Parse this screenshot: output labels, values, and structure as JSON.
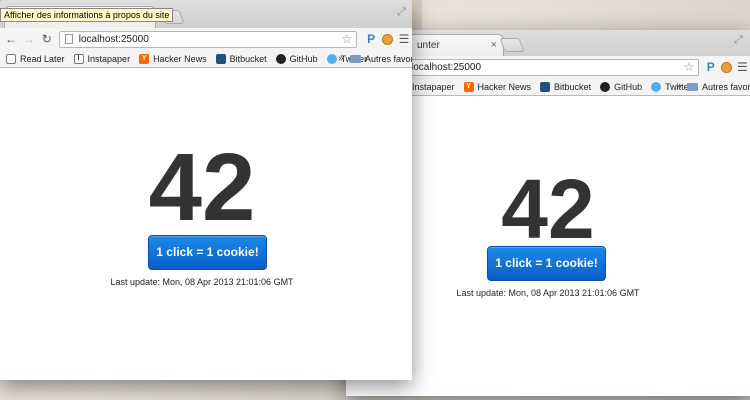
{
  "tooltip": "Afficher des informations à propos du site",
  "bookmarks": [
    {
      "label": "Read Later",
      "icon": "read-later-icon"
    },
    {
      "label": "Instapaper",
      "icon": "instapaper-icon"
    },
    {
      "label": "Hacker News",
      "icon": "hacker-news-icon",
      "glyph": "Y"
    },
    {
      "label": "Bitbucket",
      "icon": "bitbucket-icon"
    },
    {
      "label": "GitHub",
      "icon": "github-icon"
    },
    {
      "label": "Twitter",
      "icon": "twitter-icon"
    }
  ],
  "bookmarks_more": "»",
  "other_bookmarks": "Autres favoris",
  "left": {
    "url": "localhost:25000",
    "count": "42",
    "button_label": "1 click = 1 cookie!",
    "last_update": "Last update: Mon, 08 Apr 2013 21:01:06 GMT"
  },
  "right": {
    "tab_title": "unter",
    "url": "localhost:25000",
    "count": "42",
    "button_label": "1 click = 1 cookie!",
    "last_update": "Last update: Mon, 08 Apr 2013 21:01:06 GMT"
  },
  "colors": {
    "button": "#0f6fd6",
    "counter": "#333333"
  }
}
